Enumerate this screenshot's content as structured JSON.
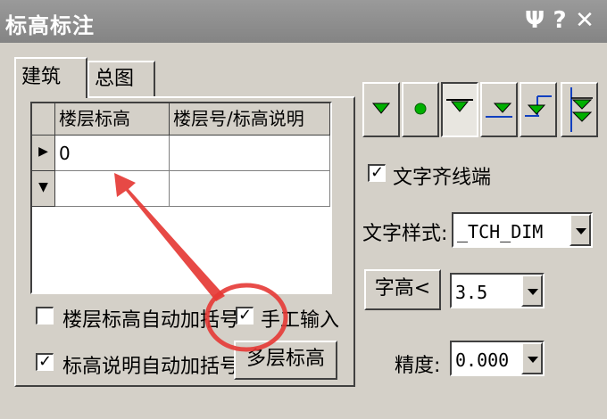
{
  "window": {
    "title": "标高标注"
  },
  "titlebar": {
    "pin_glyph": "Ψ",
    "help_glyph": "?",
    "close_glyph": "✕"
  },
  "tabs": [
    {
      "label": "建筑"
    },
    {
      "label": "总图"
    }
  ],
  "grid": {
    "columns": [
      "楼层标高",
      "楼层号/标高说明"
    ],
    "rows": [
      {
        "elevation": "0",
        "note": ""
      },
      {
        "elevation": "",
        "note": ""
      }
    ]
  },
  "options": {
    "auto_bracket_floor": {
      "label": "楼层标高自动加括号",
      "checked": false
    },
    "manual_input": {
      "label": "手工输入",
      "checked": true,
      "check_glyph": "✓"
    },
    "auto_bracket_note": {
      "label": "标高说明自动加括号",
      "checked": true,
      "check_glyph": "✓"
    }
  },
  "multi_level_button": {
    "label": "多层标高"
  },
  "toolbar": {
    "icons": [
      "triangle-down-icon",
      "circle-icon",
      "triangle-underline-icon",
      "outline-triangle-line-icon",
      "triangle-left-line-icon",
      "double-triangle-icon"
    ]
  },
  "align_text": {
    "label": "文字齐线端",
    "checked": true,
    "check_glyph": "✓"
  },
  "text_style": {
    "label": "文字样式:",
    "value": "_TCH_DIM"
  },
  "text_height": {
    "button_label": "字高<",
    "value": "3.5"
  },
  "precision": {
    "label": "精度:",
    "value": "0.000"
  },
  "colors": {
    "icon_green": "#00b000",
    "icon_blue": "#1040c0",
    "annotation_red": "#e53935"
  }
}
